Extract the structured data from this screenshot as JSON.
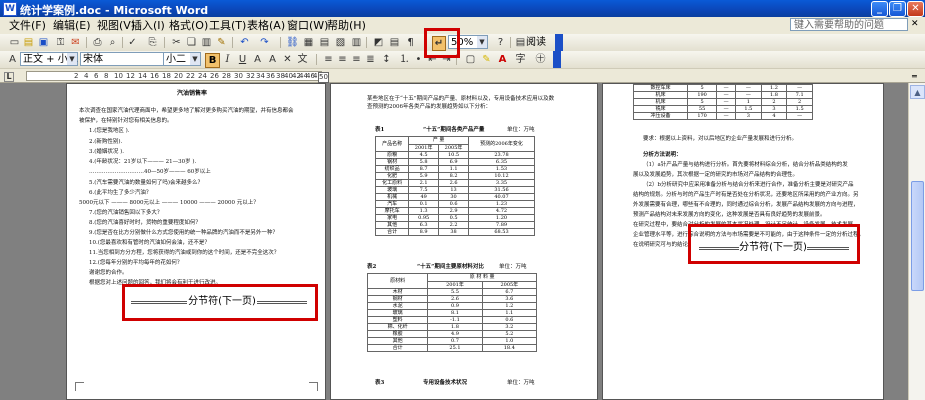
{
  "window": {
    "title": "统计学案例.doc - Microsoft Word",
    "icon_label": "W",
    "minimize_label": "_",
    "restore_label": "❐",
    "close_label": "✕"
  },
  "menu": {
    "items": [
      "文件(F)",
      "编辑(E)",
      "视图(V)",
      "插入(I)",
      "格式(O)",
      "工具(T)",
      "表格(A)",
      "窗口(W)",
      "帮助(H)"
    ],
    "help_placeholder": "键入需要帮助的问题"
  },
  "toolbar1": {
    "zoom": "50%",
    "read_label": "阅读",
    "paragraph_mark": "↵"
  },
  "toolbar2": {
    "style": "正文 + 小二",
    "font": "宋体",
    "size": "小二",
    "bold_label": "B",
    "italic_label": "I",
    "underline_label": "U",
    "font_color_label": "A"
  },
  "ruler": {
    "ticks": [
      "L",
      "2",
      "4",
      "6",
      "8",
      "10",
      "12",
      "14",
      "16",
      "18",
      "20",
      "22",
      "24",
      "26",
      "28",
      "30",
      "32",
      "34",
      "36",
      "38",
      "40",
      "42",
      "44",
      "46",
      "48",
      "50"
    ]
  },
  "pages": {
    "left": {
      "heading": "汽油销售率",
      "lines": [
        "本次调查在国家汽油代理商面中，希望更多地了解对更多购买汽油的期望，并有信息都会",
        "被保护，在特别针对您有相关信息的。",
        "1.(您是我地区 ).",
        "2.(新购性别).",
        "3.(婚姻状况 ).",
        "4.(年龄状况：21岁以下——— 21—30岁 ).",
        "…………………………40—50岁——— 60岁以上",
        "5.(汽车需要汽油的数量如何了吗)会来越多么？",
        "6.(此平均生了多少汽油？ ",
        "5000元以下 ——— 8000元以上 ——— 10000 ——— 20000 元以上？ ",
        "7.(您的汽油销售回以下多大？ ",
        "8.(您的汽油喜好时时，货物的重要程度如何？ ",
        "9.(您是否在比方分别做什么方式您使用的统一种品牌的汽油而不是另外一种？ ",
        "10.(您最喜欢和有管时的汽油如何会油，还不是？ ",
        "11.当您相到方分方程，您将获得的汽油或到你的这个时间，还是不完全这次？ ",
        "12.(您每年分别的平均每年的花如何？ ",
        "谢谢您的合作。",
        "根据您对上述问题的回答，我们将会有利于进行改进。"
      ]
    },
    "middle": {
      "intro_lines": [
        "某些地区在于“十五”期间产品的产量、原材料以及，专用设备技术应用以及数",
        "查预测的2006年各类产品的发展趋势如以下分析："
      ],
      "table1": {
        "caption": "表1",
        "title": "“十五”期间各类产品产量",
        "unit": "单位：万吨",
        "header": [
          "产品名称",
          "2001年",
          "2005年",
          "预测的2006年变化"
        ],
        "rows": [
          [
            "原粮",
            "4.5",
            "10.5",
            "23.78"
          ],
          [
            "钢材",
            "5.8",
            "6.9",
            "6.35"
          ],
          [
            "纺织品",
            "8.7",
            "1.1",
            "1.53"
          ],
          [
            "化肥",
            "5.9",
            "8.2",
            "10.12"
          ],
          [
            "化工原料",
            "2.1",
            "2.6",
            "3.35"
          ],
          [
            "玻璃",
            "7.5",
            "13",
            "31.56"
          ],
          [
            "机械",
            "49",
            "30",
            "40.07"
          ],
          [
            "汽车",
            "0.1",
            "0.6",
            "1.23"
          ],
          [
            "摩托车",
            "1.3",
            "2.9",
            "4.72"
          ],
          [
            "家电",
            "0.95",
            "0.5",
            "1.20"
          ],
          [
            "其他",
            "6.3",
            "2.2",
            "7.89"
          ],
          [
            "合计",
            "8.9",
            "38",
            "68.53"
          ]
        ]
      },
      "table2": {
        "caption": "表2",
        "title": "“十五”期间主要原材料对比",
        "unit": "单位：万吨",
        "header": [
          "原材料",
          "2001年",
          "2005年"
        ],
        "rows": [
          [
            "木材",
            "5.5",
            "6.7"
          ],
          [
            "钢材",
            "2.6",
            "3.6"
          ],
          [
            "水泥",
            "0.9",
            "1.2"
          ],
          [
            "玻璃",
            "8.1",
            "1.1"
          ],
          [
            "塑料",
            "-1.1",
            "0.6"
          ],
          [
            "棉、化纤",
            "1.8",
            "3.2"
          ],
          [
            "橡胶",
            "4.9",
            "5.2"
          ],
          [
            "其他",
            "0.7",
            "1.0"
          ],
          [
            "合计",
            "25.1",
            "18.4"
          ]
        ]
      },
      "table3": {
        "caption": "表3",
        "title": "专用设备技术状况",
        "unit": "单位：万吨"
      }
    },
    "right": {
      "table_rows": [
        [
          "数控车床",
          "5",
          "—",
          "—",
          "1.2",
          "—"
        ],
        [
          "机床",
          "190",
          "—",
          "—",
          "1.8",
          "7.1"
        ],
        [
          "机床",
          "5",
          "—",
          "1",
          "2",
          "2"
        ],
        [
          "铣床",
          "55",
          "—",
          "1.5",
          "3",
          "1.5"
        ],
        [
          "冲压设备",
          "170",
          "—",
          "3",
          "4",
          "—"
        ]
      ],
      "note": "要求：根据以上资料，对以后地区的企业产量发展和进行分析。",
      "section_title": "分析方法说明：",
      "lines": [
        "（1）a针产品产量与结构进行分析。首先要将材料综合分析，结合分析品类结构的发",
        "展以及发展趋势，其次根据一定的研究的市场对产品结构的合理性。",
        "（2）b分析研究中应采用准备分析与结合分析来进行合作，准备分析主要是对研究产品",
        "结构的规划。分析与时的产品生产时有是否处在分析状况，还要地区所采用的的产业方向。另",
        "外发展需要有合理，哪些有不合理的，同时通过综合分析，发展产品结构发展的方向与进程，",
        "预测产品结构对未来发展方向的变化，这种发展是否具有良好趋势的发展前景。",
        "在研究过程中，要结合对分析的发展的基本状况处理，设计不足统计，设备发展，技术发展，",
        "企业管理水平等，进行综合说明的方法与市场需要是不可能的，由于这种条件一定的分析过程，",
        "在说明研究可与的结论。"
      ]
    }
  },
  "section_break_label": "分节符(下一页)"
}
